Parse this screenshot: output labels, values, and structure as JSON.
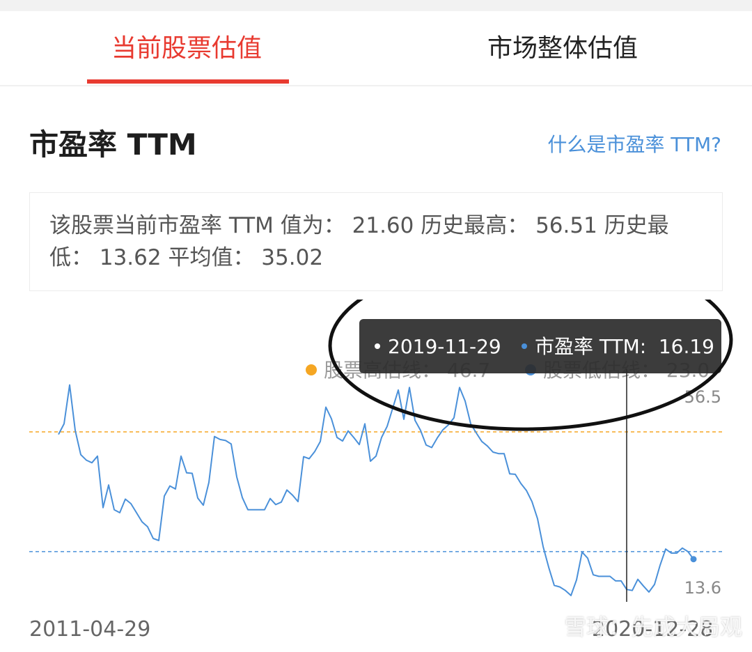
{
  "tabs": {
    "active_label": "当前股票估值",
    "inactive_label": "市场整体估值"
  },
  "section": {
    "title": "市盈率 TTM",
    "help_link": "什么是市盈率 TTM?"
  },
  "summary": {
    "text": "该股票当前市盈率 TTM 值为： 21.60 历史最高： 56.51 历史最低： 13.62 平均值： 35.02"
  },
  "colors": {
    "accent_red": "#e83a30",
    "line_blue": "#4a90d9",
    "high_line_orange": "#f5a623",
    "tooltip_bg": "#2b2b2b"
  },
  "chart_data": {
    "type": "line",
    "x_start": "2011-04-29",
    "x_end": "2020-12-28",
    "ylim": [
      13.6,
      56.5
    ],
    "y_max_label": "56.5",
    "y_min_label": "13.6",
    "legend": [
      {
        "name": "股票高估线",
        "value": "46.7",
        "color": "#f5a623"
      },
      {
        "name": "股票低估线",
        "value": "23.0",
        "color": "#4a90d9"
      }
    ],
    "reference_lines": [
      {
        "name": "股票高估线",
        "y": 46.7,
        "color": "#f5a623"
      },
      {
        "name": "股票低估线",
        "y": 23.0,
        "color": "#4a90d9"
      }
    ],
    "series": [
      {
        "name": "市盈率 TTM",
        "values": [
          46.2,
          48.3,
          56.0,
          47.0,
          42.2,
          41.1,
          40.6,
          41.9,
          31.7,
          36.2,
          31.3,
          30.7,
          33.4,
          32.5,
          30.7,
          28.9,
          27.9,
          25.6,
          25.2,
          34.0,
          36.0,
          35.4,
          41.9,
          38.6,
          38.5,
          33.6,
          32.2,
          36.7,
          45.8,
          45.2,
          45.0,
          44.3,
          37.8,
          33.7,
          31.3,
          31.3,
          31.3,
          31.3,
          33.5,
          32.3,
          32.8,
          35.2,
          34.2,
          32.9,
          41.8,
          41.4,
          42.8,
          44.8,
          51.6,
          49.3,
          45.6,
          44.9,
          46.9,
          45.6,
          44.2,
          48.3,
          40.9,
          41.9,
          45.6,
          47.8,
          51.4,
          55.0,
          49.2,
          55.5,
          49.0,
          47.0,
          44.1,
          43.6,
          45.5,
          47.1,
          48.1,
          49.5,
          55.5,
          52.8,
          48.3,
          46.5,
          44.8,
          43.9,
          42.7,
          42.4,
          42.4,
          38.4,
          38.3,
          36.5,
          35.1,
          32.9,
          29.5,
          24.0,
          19.9,
          16.3,
          16.0,
          15.3,
          14.3,
          17.4,
          22.9,
          21.7,
          18.4,
          18.1,
          18.1,
          18.1,
          17.2,
          17.2,
          15.5,
          15.3,
          17.5,
          16.2,
          15.0,
          16.5,
          20.3,
          23.5,
          22.7,
          22.7,
          23.7,
          23.0,
          21.5
        ]
      }
    ],
    "tooltip": {
      "date": "2019-11-29",
      "series_name": "市盈率 TTM",
      "value": "16.19"
    }
  },
  "footer": {
    "date_start": "2011-04-29",
    "date_end": "2020-12-28",
    "watermark": "雪球：先成大局观"
  }
}
